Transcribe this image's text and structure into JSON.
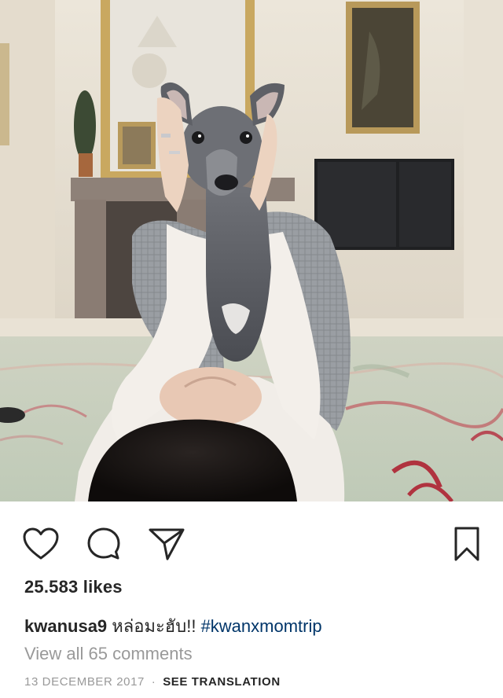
{
  "post": {
    "image_alt": "Woman lying on a rug holding up a small grey dog",
    "likes_text": "25.583 likes",
    "caption": {
      "username": "kwanusa9",
      "text": "หล่อมะฮับ!!",
      "hashtag": "#kwanxmomtrip"
    },
    "comments_link": "View all 65 comments",
    "date": "13 DECEMBER 2017",
    "separator": "·",
    "translation_link": "SEE TRANSLATION"
  },
  "actions": {
    "like_icon": "heart-outline-icon",
    "comment_icon": "speech-bubble-icon",
    "share_icon": "paper-plane-icon",
    "save_icon": "bookmark-outline-icon"
  },
  "colors": {
    "text": "#262626",
    "muted": "#999999",
    "hashtag": "#003569",
    "background": "#ffffff"
  }
}
